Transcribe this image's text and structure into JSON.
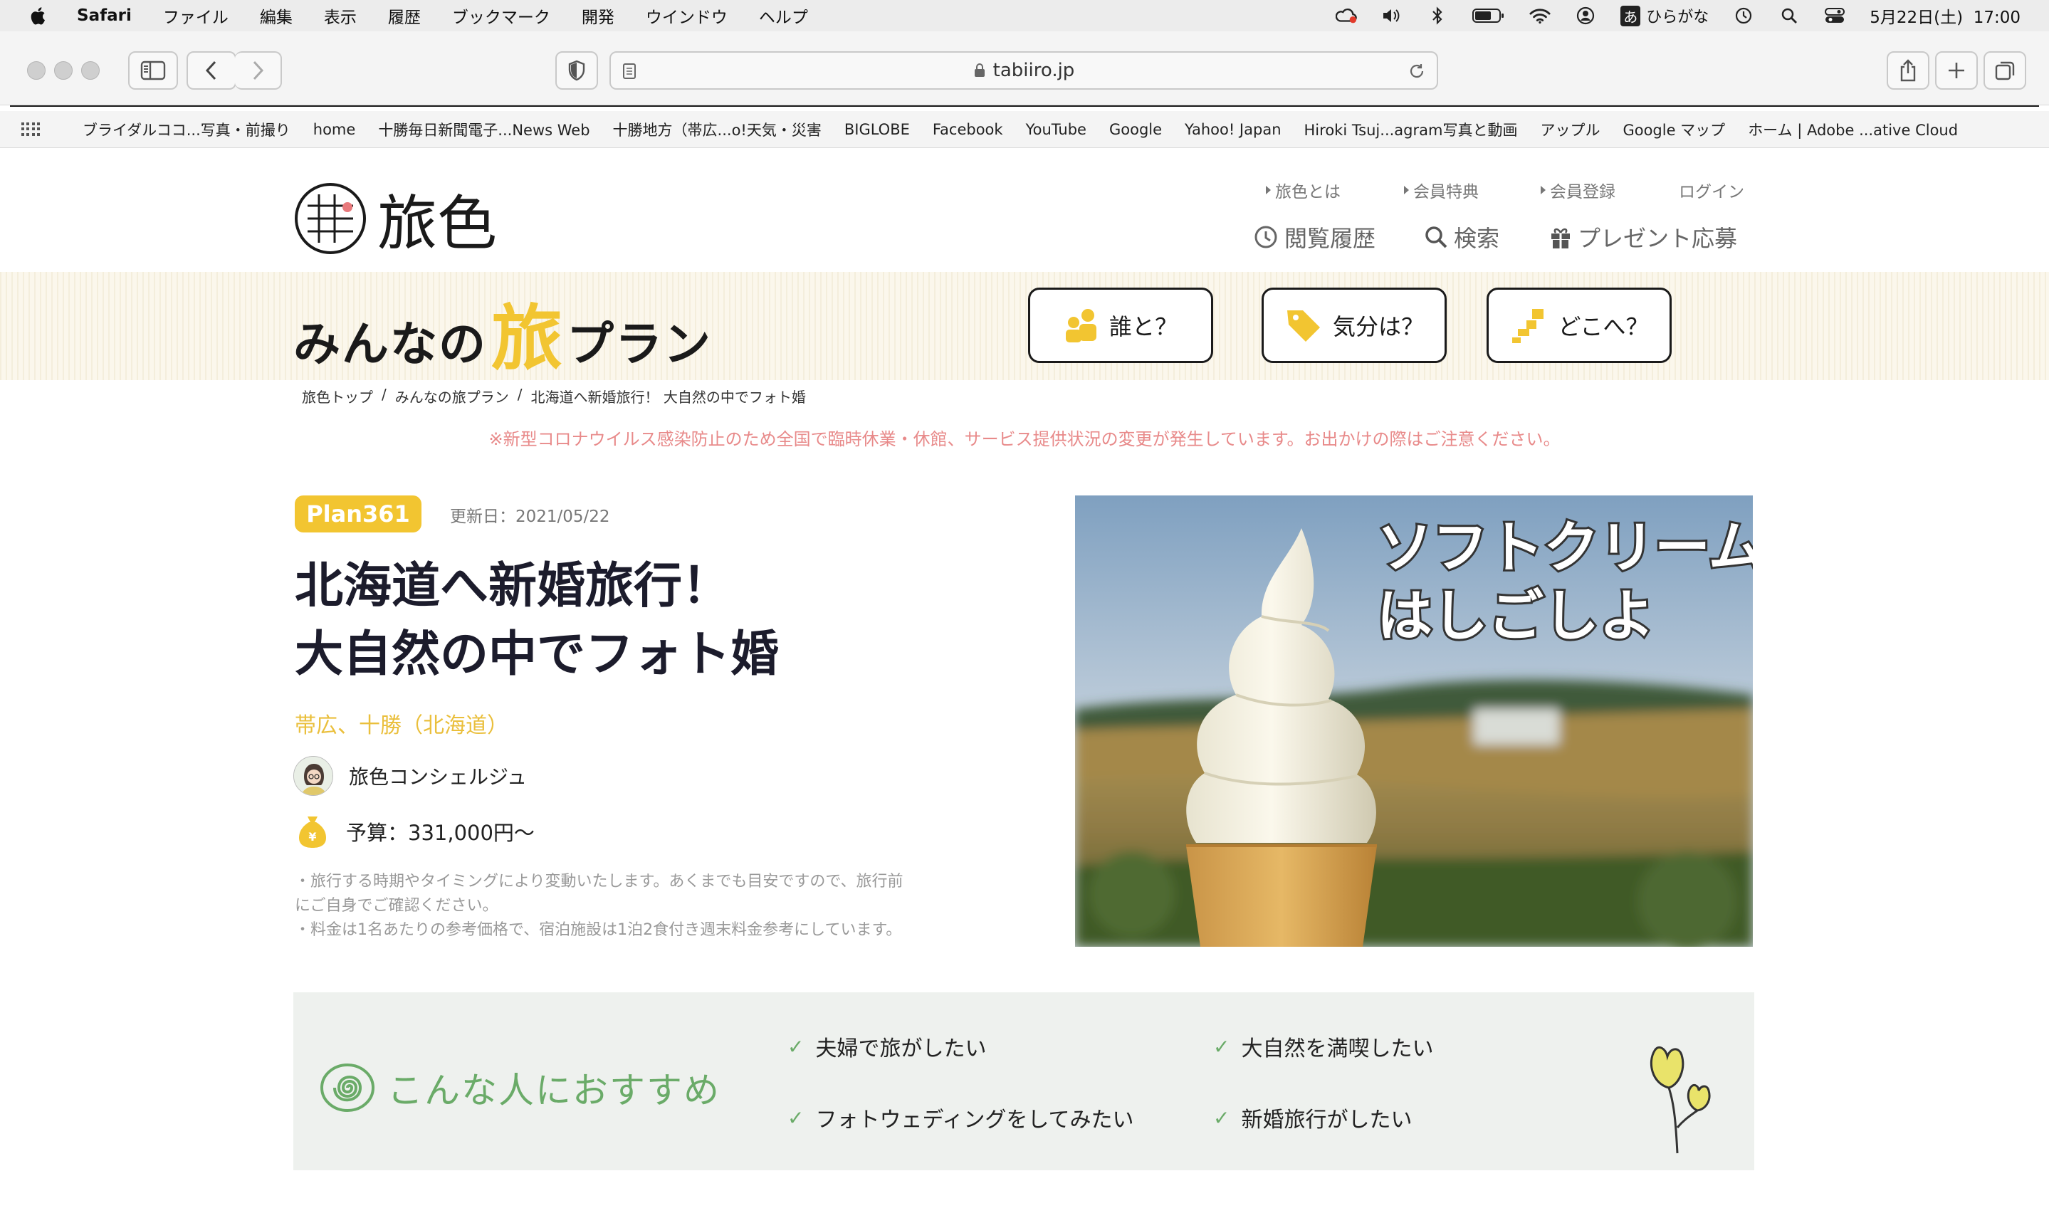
{
  "menubar": {
    "app": "Safari",
    "items": [
      "ファイル",
      "編集",
      "表示",
      "履歴",
      "ブックマーク",
      "開発",
      "ウインドウ",
      "ヘルプ"
    ],
    "input_mode": "ひらがな",
    "input_badge": "あ",
    "datetime": "5月22日(土)  17:00"
  },
  "browser": {
    "url": "tabiiro.jp",
    "bookmarks": [
      "ブライダルココ...写真・前撮り",
      "home",
      "十勝毎日新聞電子...News Web",
      "十勝地方（帯広...o!天気・災害",
      "BIGLOBE",
      "Facebook",
      "YouTube",
      "Google",
      "Yahoo! Japan",
      "Hiroki Tsuj...agram写真と動画",
      "アップル",
      "Google マップ",
      "ホーム | Adobe ...ative Cloud"
    ]
  },
  "site": {
    "logo_text": "旅色",
    "top_links": [
      "旅色とは",
      "会員特典",
      "会員登録",
      "ログイン"
    ],
    "nav": [
      "閲覧履歴",
      "検索",
      "プレゼント応募"
    ],
    "band_title_a": "みんなの",
    "band_title_b": "旅",
    "band_title_c": "プラン",
    "band_buttons": [
      "誰と？",
      "気分は？",
      "どこへ？"
    ],
    "breadcrumb": [
      "旅色トップ",
      "/",
      "みんなの旅プラン",
      "/",
      "北海道へ新婚旅行！ 大自然の中でフォト婚"
    ],
    "notice": "※新型コロナウイルス感染防止のため全国で臨時休業・休館、サービス提供状況の変更が発生しています。お出かけの際はご注意ください。"
  },
  "plan": {
    "badge": "Plan361",
    "updated": "更新日：2021/05/22",
    "title_line1": "北海道へ新婚旅行！",
    "title_line2": "大自然の中でフォト婚",
    "area": "帯広、十勝（北海道）",
    "author": "旅色コンシェルジュ",
    "budget": "予算：331,000円〜",
    "notes": [
      "・旅行する時期やタイミングにより変動いたします。あくまでも目安ですので、旅行前",
      "にご自身でご確認ください。",
      "・料金は1名あたりの参考価格で、宿泊施設は1泊2食付き週末料金参考にしています。"
    ],
    "hero_caption_1": "ソフトクリーム",
    "hero_caption_2": "はしごしよ"
  },
  "recommend": {
    "title": "こんな人におすすめ",
    "items": [
      "夫婦で旅がしたい",
      "大自然を満喫したい",
      "フォトウェディングをしてみたい",
      "新婚旅行がしたい"
    ],
    "check": "✓"
  },
  "colors": {
    "accent_yellow": "#f2c531",
    "accent_green": "#6aab68",
    "notice_red": "#e88a8a"
  }
}
